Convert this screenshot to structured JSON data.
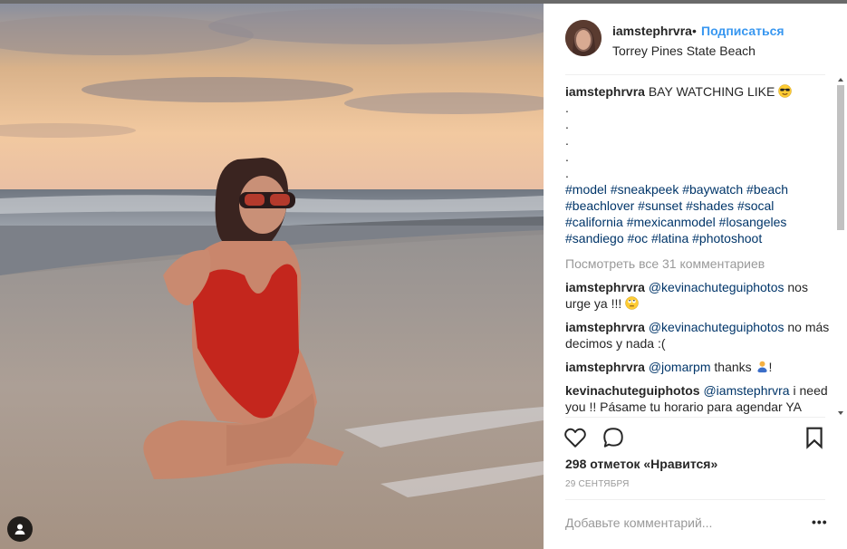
{
  "post": {
    "username": "iamstephrvra",
    "separator": "•",
    "follow_label": "Подписаться",
    "location": "Torrey Pines State Beach",
    "caption_username": "iamstephrvra",
    "caption_text": "BAY WATCHING LIKE",
    "caption_dots": [
      ".",
      ".",
      ".",
      ".",
      "."
    ],
    "hashtags": [
      "#model",
      "#sneakpeek",
      "#baywatch",
      "#beach",
      "#beachlover",
      "#sunset",
      "#shades",
      "#socal",
      "#california",
      "#mexicanmodel",
      "#losangeles",
      "#sandiego",
      "#oc",
      "#latina",
      "#photoshoot"
    ],
    "view_all_comments": "Посмотреть все 31 комментариев",
    "comments": [
      {
        "user": "iamstephrvra",
        "mention": "@kevinachuteguiphotos",
        "text": "nos urge ya !!!",
        "emoji": "rolling-eyes-emoji"
      },
      {
        "user": "iamstephrvra",
        "mention": "@kevinachuteguiphotos",
        "text": "no más decimos y nada :("
      },
      {
        "user": "iamstephrvra",
        "mention": "@jomarpm",
        "text": "thanks",
        "tail": "!",
        "emoji": "person-emoji"
      },
      {
        "user": "kevinachuteguiphotos",
        "mention": "@iamstephrvra",
        "text": "i need you !! Pásame tu horario para agendar YA"
      }
    ],
    "likes": "298 отметок «Нравится»",
    "date": "29 СЕНТЯБРЯ",
    "add_comment_placeholder": "Добавьте комментарий...",
    "more_label": "•••"
  },
  "icons": {
    "like": "heart-icon",
    "comment": "comment-bubble-icon",
    "save": "bookmark-icon",
    "tag": "user-tag-icon"
  },
  "colors": {
    "link": "#3897f0",
    "hashtag": "#003569",
    "muted": "#999999"
  }
}
